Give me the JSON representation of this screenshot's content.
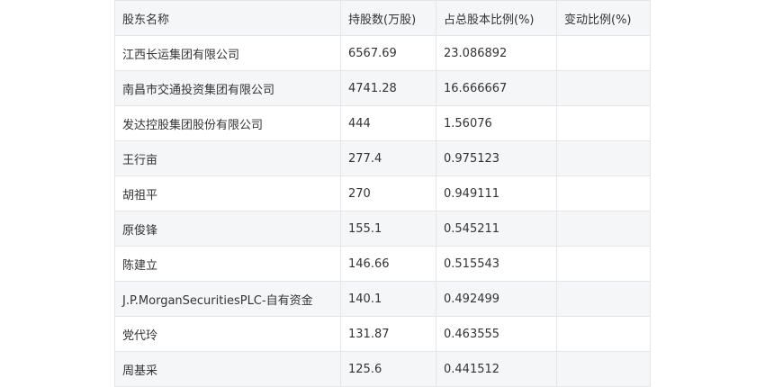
{
  "table": {
    "headers": [
      "股东名称",
      "持股数(万股)",
      "占总股本比例(%)",
      "变动比例(%)"
    ],
    "rows": [
      [
        "江西长运集团有限公司",
        "6567.69",
        "23.086892",
        ""
      ],
      [
        "南昌市交通投资集团有限公司",
        "4741.28",
        "16.666667",
        ""
      ],
      [
        "发达控股集团股份有限公司",
        "444",
        "1.56076",
        ""
      ],
      [
        "王行亩",
        "277.4",
        "0.975123",
        ""
      ],
      [
        "胡祖平",
        "270",
        "0.949111",
        ""
      ],
      [
        "原俊锋",
        "155.1",
        "0.545211",
        ""
      ],
      [
        "陈建立",
        "146.66",
        "0.515543",
        ""
      ],
      [
        "J.P.MorganSecuritiesPLC-自有资金",
        "140.1",
        "0.492499",
        ""
      ],
      [
        "党代玲",
        "131.87",
        "0.463555",
        ""
      ],
      [
        "周基采",
        "125.6",
        "0.441512",
        ""
      ]
    ]
  }
}
